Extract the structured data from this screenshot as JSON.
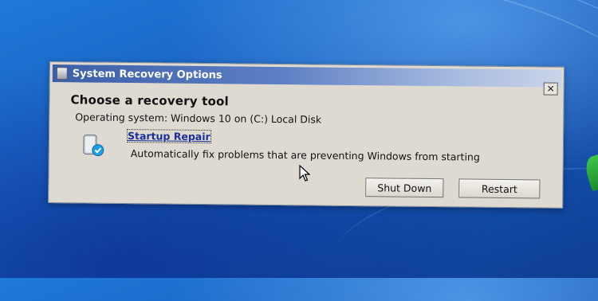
{
  "dialog": {
    "title": "System Recovery Options",
    "close_label": "✕",
    "heading": "Choose a recovery tool",
    "os_line": "Operating system: Windows 10 on (C:) Local Disk",
    "tool": {
      "name": "Startup Repair",
      "description": "Automatically fix problems that are preventing Windows from starting",
      "icon": "startup-repair-icon"
    },
    "buttons": {
      "shutdown": "Shut Down",
      "restart": "Restart"
    }
  },
  "colors": {
    "desktop": "#1a63c4",
    "titlebar": "#3c5ea8",
    "dialog_bg": "#dedad2",
    "link": "#1b2f9c"
  }
}
